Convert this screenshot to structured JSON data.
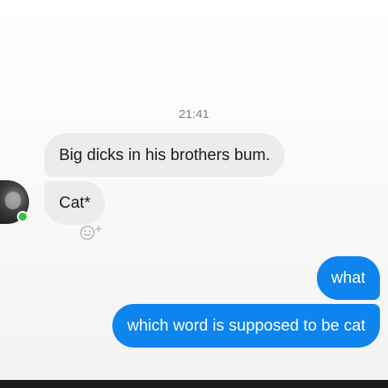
{
  "chat": {
    "timestamp": "21:41",
    "messages": [
      {
        "direction": "incoming",
        "text": "Big dicks in his brothers bum."
      },
      {
        "direction": "incoming",
        "text": "Cat*"
      },
      {
        "direction": "outgoing",
        "text": "what"
      },
      {
        "direction": "outgoing",
        "text": "which word is supposed to be cat"
      }
    ],
    "contact_status": "online",
    "reaction_icon": "smiley-plus-icon"
  },
  "colors": {
    "outgoing_bubble": "#0d84ee",
    "incoming_bubble": "#ececec",
    "online_indicator": "#35c24a",
    "timestamp_text": "#7d7d7d"
  }
}
